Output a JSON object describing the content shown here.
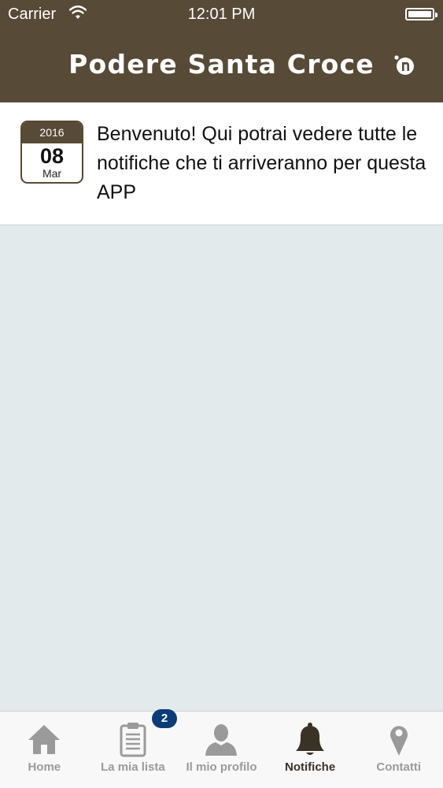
{
  "status_bar": {
    "carrier": "Carrier",
    "time": "12:01 PM"
  },
  "header": {
    "title": "Podere Santa Croce",
    "logo_icon": "n-logo-icon"
  },
  "notifications": [
    {
      "year": "2016",
      "day": "08",
      "month": "Mar",
      "text": "Benvenuto! Qui potrai vedere tutte le notifiche che ti arriveranno per questa APP"
    }
  ],
  "tab_bar": {
    "tabs": [
      {
        "label": "Home",
        "icon": "home-icon"
      },
      {
        "label": "La mia lista",
        "icon": "clipboard-icon",
        "badge": "2"
      },
      {
        "label": "Il mio profilo",
        "icon": "user-icon"
      },
      {
        "label": "Notifiche",
        "icon": "bell-icon",
        "active": true
      },
      {
        "label": "Contatti",
        "icon": "location-pin-icon"
      }
    ]
  },
  "colors": {
    "header": "#574a36",
    "background": "#e3eaeb",
    "badge": "#0a3c78",
    "tab_inactive": "#9a9a9a",
    "tab_active": "#3b3226"
  }
}
